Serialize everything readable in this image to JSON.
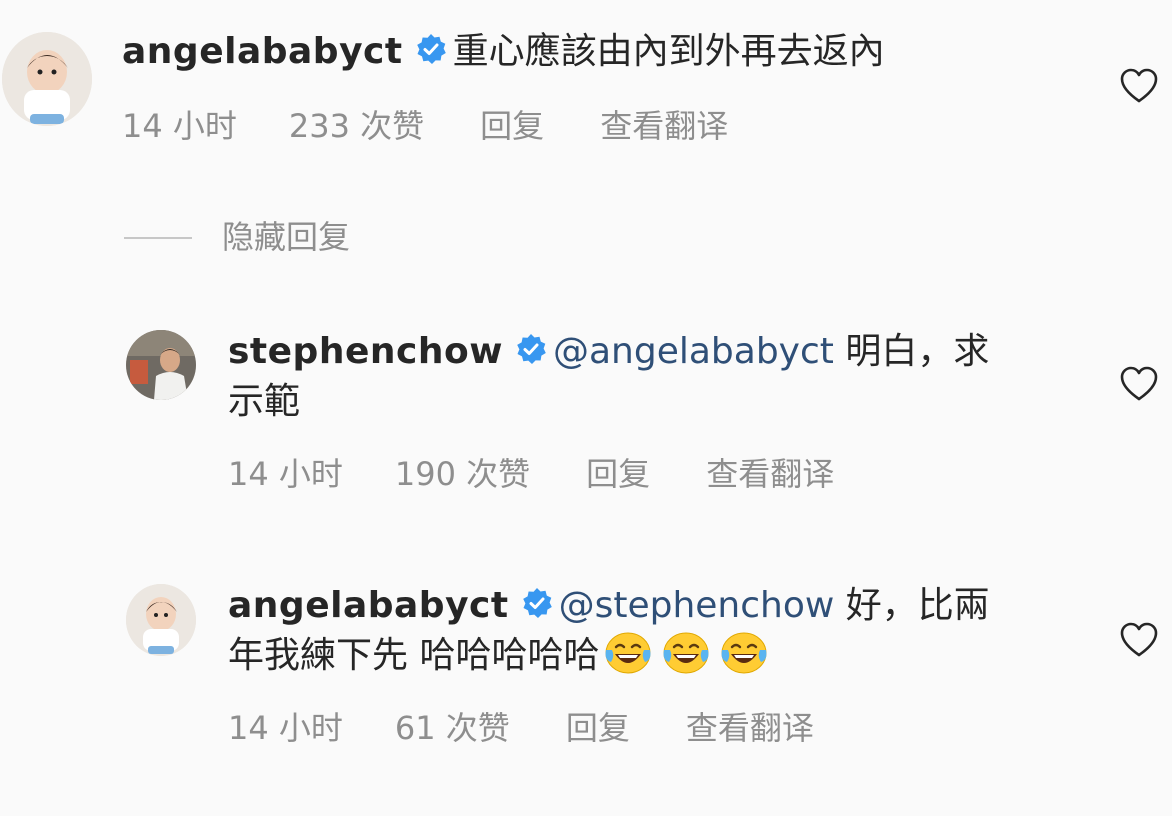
{
  "comments": [
    {
      "username": "angelababyct",
      "mention": "",
      "text_line1": "重心應該由內到外再去返內",
      "text_line2": "",
      "time": "14 小时",
      "likes": "233 次赞",
      "reply": "回复",
      "translate": "查看翻译"
    },
    {
      "username": "stephenchow",
      "mention": "@angelababyct",
      "text_line1": "明白，求",
      "text_line2": "示範",
      "time": "14 小时",
      "likes": "190 次赞",
      "reply": "回复",
      "translate": "查看翻译"
    },
    {
      "username": "angelababyct",
      "mention": "@stephenchow",
      "text_line1": "好，比兩",
      "text_line2": "年我練下先 哈哈哈哈哈",
      "emoji": [
        "face-with-tears-of-joy",
        "face-with-tears-of-joy",
        "face-with-tears-of-joy"
      ],
      "time": "14 小时",
      "likes": "61 次赞",
      "reply": "回复",
      "translate": "查看翻译"
    }
  ],
  "hide_replies": "隐藏回复",
  "colors": {
    "verified": "#3897f0",
    "mention": "#2f4f77",
    "meta": "#8e8e8e",
    "background": "#fafafa"
  }
}
